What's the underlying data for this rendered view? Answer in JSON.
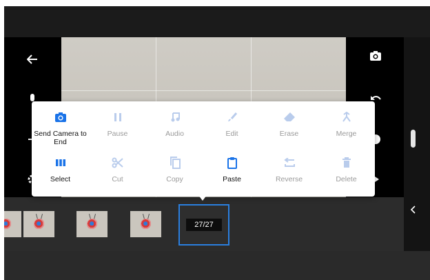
{
  "colors": {
    "accent": "#1a73e8",
    "disabled": "#b9ccec",
    "frame": "#1b1b1b",
    "selection": "#2a7fe0"
  },
  "side_icons": {
    "left": [
      "back-arrow-icon",
      "microphone-icon",
      "add-icon",
      "settings-icon"
    ],
    "right": [
      "camera-icon",
      "undo-icon",
      "help-icon",
      "play-icon"
    ]
  },
  "menu": {
    "row1": [
      {
        "label": "Send Camera to End",
        "icon": "camera-icon",
        "enabled": true
      },
      {
        "label": "Pause",
        "icon": "pause-icon",
        "enabled": false
      },
      {
        "label": "Audio",
        "icon": "music-note-icon",
        "enabled": false
      },
      {
        "label": "Edit",
        "icon": "brush-icon",
        "enabled": false
      },
      {
        "label": "Erase",
        "icon": "eraser-icon",
        "enabled": false
      },
      {
        "label": "Merge",
        "icon": "merge-icon",
        "enabled": false
      }
    ],
    "row2": [
      {
        "label": "Select",
        "icon": "select-frames-icon",
        "enabled": true
      },
      {
        "label": "Cut",
        "icon": "scissors-icon",
        "enabled": false
      },
      {
        "label": "Copy",
        "icon": "copy-icon",
        "enabled": false
      },
      {
        "label": "Paste",
        "icon": "clipboard-icon",
        "enabled": true
      },
      {
        "label": "Reverse",
        "icon": "reverse-icon",
        "enabled": false
      },
      {
        "label": "Delete",
        "icon": "trash-icon",
        "enabled": false
      }
    ]
  },
  "timeline": {
    "frame_counter": "27/27",
    "thumbnail_count": 4
  }
}
